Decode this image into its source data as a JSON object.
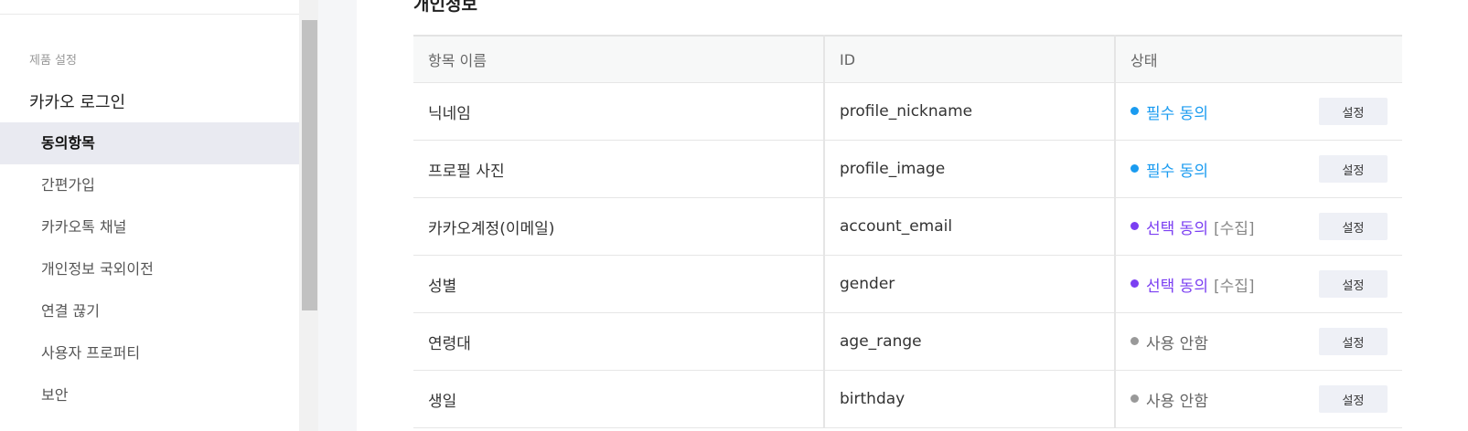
{
  "sidebar": {
    "section_label": "제품 설정",
    "group_title": "카카오 로그인",
    "items": [
      {
        "label": "동의항목",
        "active": true
      },
      {
        "label": "간편가입",
        "active": false
      },
      {
        "label": "카카오톡 채널",
        "active": false
      },
      {
        "label": "개인정보 국외이전",
        "active": false
      },
      {
        "label": "연결 끊기",
        "active": false
      },
      {
        "label": "사용자 프로퍼티",
        "active": false
      },
      {
        "label": "보안",
        "active": false
      }
    ]
  },
  "main": {
    "section_title": "개인정보",
    "table": {
      "headers": {
        "name": "항목 이름",
        "id": "ID",
        "status": "상태"
      },
      "rows": [
        {
          "name": "닉네임",
          "id": "profile_nickname",
          "status": "필수 동의",
          "extra": "",
          "status_color": "#1a9bf0",
          "button": "설정"
        },
        {
          "name": "프로필 사진",
          "id": "profile_image",
          "status": "필수 동의",
          "extra": "",
          "status_color": "#1a9bf0",
          "button": "설정"
        },
        {
          "name": "카카오계정(이메일)",
          "id": "account_email",
          "status": "선택 동의",
          "extra": "[수집]",
          "status_color": "#7b3ff2",
          "button": "설정"
        },
        {
          "name": "성별",
          "id": "gender",
          "status": "선택 동의",
          "extra": "[수집]",
          "status_color": "#7b3ff2",
          "button": "설정"
        },
        {
          "name": "연령대",
          "id": "age_range",
          "status": "사용 안함",
          "extra": "",
          "status_color": "#999999",
          "button": "설정"
        },
        {
          "name": "생일",
          "id": "birthday",
          "status": "사용 안함",
          "extra": "",
          "status_color": "#999999",
          "button": "설정"
        }
      ]
    }
  },
  "colors": {
    "required": "#1a9bf0",
    "optional": "#7b3ff2",
    "unused": "#999999"
  }
}
